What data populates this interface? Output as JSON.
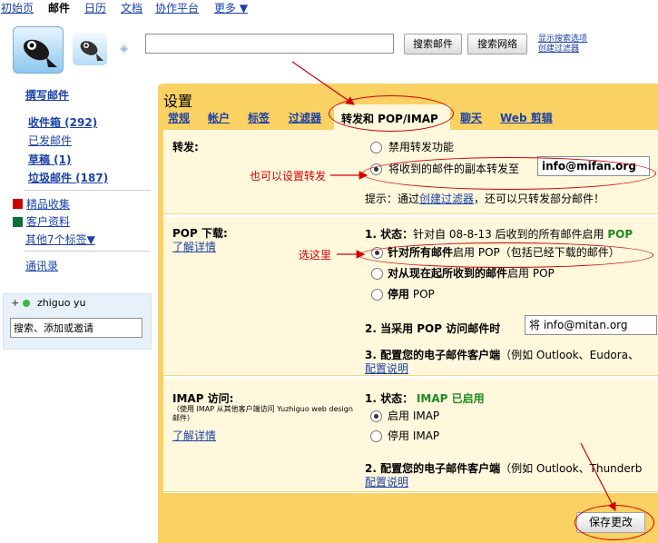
{
  "topnav": {
    "items": [
      "初始页",
      "邮件",
      "日历",
      "文档",
      "协作平台",
      "更多 ▼"
    ]
  },
  "search": {
    "mail_button": "搜索邮件",
    "web_button": "搜索网络",
    "options_line1": "显示搜索选项",
    "options_line2": "创建过滤器"
  },
  "sidebar": {
    "compose": "撰写邮件",
    "inbox": "收件箱 (292)",
    "sent": "已发邮件",
    "drafts": "草稿 (1)",
    "spam": "垃圾邮件 (187)",
    "labels": [
      {
        "name": "精品收集",
        "color": "#cc0000"
      },
      {
        "name": "客户资料",
        "color": "#0b6e3a"
      }
    ],
    "more_labels": "其他7个标签▼",
    "contacts": "通讯录",
    "chat_user": "zhiguo yu",
    "chat_placeholder": "搜索、添加或邀请"
  },
  "settings": {
    "title": "设置",
    "tabs": [
      "常规",
      "帐户",
      "标签",
      "过滤器",
      "转发和 POP/IMAP",
      "聊天",
      "Web 剪辑"
    ],
    "active_tab": "转发和 POP/IMAP",
    "forwarding": {
      "heading": "转发:",
      "option_disable": "禁用转发功能",
      "option_forward": "将收到的邮件的副本转发至",
      "forward_address": "info@mifan.org",
      "tip_prefix": "提示：通过",
      "tip_link": "创建过滤器",
      "tip_suffix": "，还可以只转发部分邮件！"
    },
    "pop": {
      "heading": "POP 下载:",
      "learn_more": "了解详情",
      "status_label": "1. 状态：",
      "status_text": "针对自 08-8-13 后收到的所有邮件启用",
      "status_tag": "POP",
      "option_all_bold": "针对所有邮件",
      "option_all_rest": "启用 POP（包括已经下载的邮件）",
      "option_now_bold": "对从现在起所收到的邮件",
      "option_now_rest": "启用 POP",
      "option_disable_bold": "停用",
      "option_disable_rest": " POP",
      "access_label": "2. 当采用 POP 访问邮件时",
      "access_value": "将 info@mitan.org",
      "configure_label": "3. 配置您的电子邮件客户端",
      "configure_example": "（例如 Outlook、Eudora、",
      "configure_link": "配置说明"
    },
    "imap": {
      "heading": "IMAP 访问:",
      "note": "（使用 IMAP 从其他客户端访问 Yuzhiguo web design 邮件）",
      "learn_more": "了解详情",
      "status_label": "1. 状态：",
      "status_value": "IMAP 已启用",
      "option_enable": "启用 IMAP",
      "option_disable": "停用 IMAP",
      "configure_label": "2. 配置您的电子邮件客户端",
      "configure_example": "（例如 Outlook、Thunderb",
      "configure_link": "配置说明"
    },
    "save_button": "保存更改"
  },
  "annotations": {
    "forward_note": "也可以设置转发",
    "pop_note": "选这里",
    "color": "#d40000"
  }
}
